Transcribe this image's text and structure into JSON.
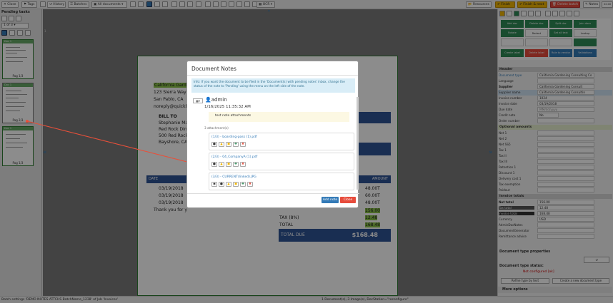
{
  "toolbar": {
    "close": "Close",
    "tags": "Tags",
    "history": "History",
    "batches": "Batches",
    "all_documents": "All documents",
    "ocr": "OCR",
    "resources": "Resources",
    "finish": "Finish",
    "finish_next": "Finish & next",
    "delete_batch": "Delete batch",
    "notes": "Notes",
    "timer": "02:00"
  },
  "left": {
    "title": "Pending tasks",
    "pager": "1 of 3",
    "thumbs": [
      {
        "header": "Doc 1",
        "footer": "Pag 1/3"
      },
      {
        "header": "Doc 1",
        "footer": "Pag 2/3"
      },
      {
        "header": "Doc 1",
        "footer": "Pag 1/3"
      }
    ]
  },
  "viewer": {
    "coords": "1",
    "doc": {
      "company": "California Garden",
      "addr1": "123 Sierra Way",
      "addr2": "San Pablo, CA",
      "email": "noreply@quickbo",
      "billto": "BILL TO",
      "bill1": "Stephanie Mar",
      "bill2": "Red Rock Dine",
      "bill3": "500 Red Rock",
      "bill4": "Bayshore, CA",
      "date_hdr": "DATE",
      "amount_hdr": "AMOUNT",
      "rows": [
        {
          "date": "03/19/2018",
          "amount": "48.00T"
        },
        {
          "date": "03/19/2018",
          "amount": "60.00T"
        },
        {
          "date": "03/19/2018",
          "amount": "48.00T"
        }
      ],
      "thanks": "Thank you for y",
      "subtotal": "156.00",
      "tax_label": "TAX (8%)",
      "tax": "12.48",
      "total_label": "TOTAL",
      "total": "168.48",
      "due_label": "TOTAL DUE",
      "due": "$168.48"
    }
  },
  "modal": {
    "title": "Document Notes",
    "info": "Info: If you want the document to be filed in the 'Document(s) with pending notes' inbox, change the status of the note to 'Pending' using the menu on the left side of the note.",
    "author": "admin",
    "date": "1/16/2025 11:35:32 AM",
    "note_text": "test note attachments",
    "attachments_label": "3 attachment(s)",
    "attachments": [
      "(1/3) - boarding-pass (1).pdf",
      "(2/3) - 04_CompanyA (1).pdf",
      "(3/3) - CURRENT(linked).JPG"
    ],
    "add_note": "Add note",
    "close": "Close"
  },
  "right": {
    "tiles": [
      {
        "label": "Add doc",
        "color": "#2e8b57"
      },
      {
        "label": "Delete doc",
        "color": "#2e8b57"
      },
      {
        "label": "Split doc",
        "color": "#2e8b57"
      },
      {
        "label": "Join docs",
        "color": "#2e8b57"
      },
      {
        "label": "Rotate",
        "color": "#2e8b57"
      },
      {
        "label": "Redact",
        "color": "#ffffff"
      },
      {
        "label": "Set all text",
        "color": "#2e8b57"
      },
      {
        "label": "Lookup",
        "color": "#ffffff"
      },
      {
        "label": "Create label",
        "color": "#2e8b57"
      },
      {
        "label": "Delete label",
        "color": "#e74c3c"
      },
      {
        "label": "Rule to vendor",
        "color": "#337ab7"
      },
      {
        "label": "Validations",
        "color": "#337ab7"
      }
    ],
    "header_sec": "Header",
    "doc_type_label": "Document type",
    "doc_type": "California Gardening Consulting Co",
    "fields": [
      {
        "label": "Language",
        "value": ""
      },
      {
        "label": "Supplier",
        "value": "California Gardening Consult"
      },
      {
        "label": "Supplier name",
        "value": "California Gardening Consultin"
      },
      {
        "label": "Invoice number",
        "value": "1024"
      },
      {
        "label": "Invoice date",
        "value": "03/19/2018"
      },
      {
        "label": "Due date",
        "value": "MM/dd/yyyy"
      },
      {
        "label": "Credit note",
        "value": "No"
      },
      {
        "label": "Order number",
        "value": ""
      }
    ],
    "optional_sec": "Optional amounts",
    "optional": [
      "Net 1",
      "Net 2",
      "Net SS5",
      "Tax 1",
      "Tax II",
      "Tax III",
      "Retention 1",
      "Discount 1",
      "Delivery cost 1",
      "Tax exemption",
      "Paidout"
    ],
    "totals_sec": "Invoice totals",
    "totals": [
      {
        "label": "Net total",
        "value": "156.00"
      },
      {
        "label": "Tax total",
        "value": "12.48"
      },
      {
        "label": "Invoice total",
        "value": "168.48"
      },
      {
        "label": "Currency",
        "value": "USD"
      },
      {
        "label": "AdminDocNotes",
        "value": ""
      },
      {
        "label": "DocumentGenerator",
        "value": ""
      },
      {
        "label": "Remittance advice",
        "value": ""
      }
    ],
    "doc_props": "Document type properties",
    "doc_type_status": "Document type status:",
    "not_configured": "Not configured [ok]",
    "refine": "Refine type by text",
    "create_new": "Create a new document type",
    "more": "More options"
  },
  "status": {
    "left": "Batch settings 'DEMO NOTES ATTCHS BatchName_1238' of Job 'Invoices'",
    "right": "1 Document(s), 3 Image(s), DocStation=\"reconfigure\""
  }
}
